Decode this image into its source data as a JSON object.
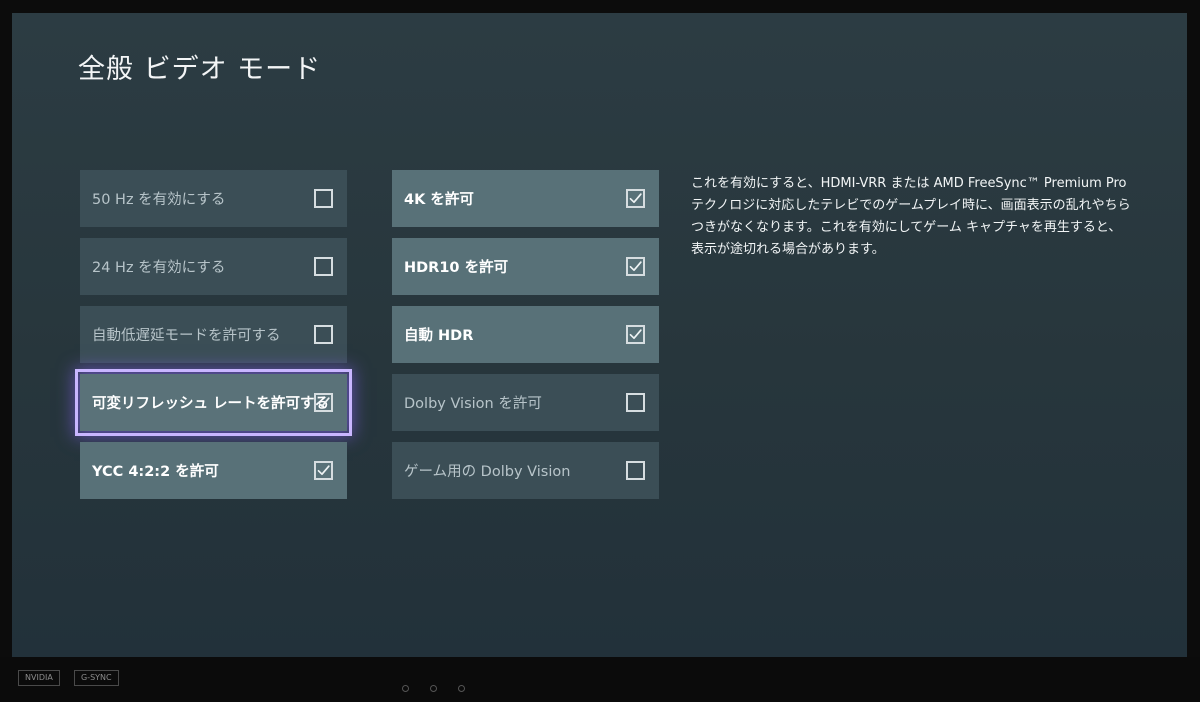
{
  "page_title": "全般 ビデオ モード",
  "left_options": [
    {
      "label": "50 Hz を有効にする",
      "checked": false,
      "state": "off"
    },
    {
      "label": "24 Hz を有効にする",
      "checked": false,
      "state": "off"
    },
    {
      "label": "自動低遅延モードを許可する",
      "checked": false,
      "state": "off"
    },
    {
      "label": "可変リフレッシュ レートを許可する",
      "checked": true,
      "state": "focused"
    },
    {
      "label": "YCC 4:2:2 を許可",
      "checked": true,
      "state": "on"
    }
  ],
  "right_options": [
    {
      "label": "4K を許可",
      "checked": true,
      "state": "on"
    },
    {
      "label": "HDR10 を許可",
      "checked": true,
      "state": "on"
    },
    {
      "label": "自動 HDR",
      "checked": true,
      "state": "on"
    },
    {
      "label": "Dolby Vision を許可",
      "checked": false,
      "state": "off"
    },
    {
      "label": "ゲーム用の Dolby Vision",
      "checked": false,
      "state": "off"
    }
  ],
  "description": "これを有効にすると、HDMI-VRR または AMD FreeSync™ Premium Pro テクノロジに対応したテレビでのゲームプレイ時に、画面表示の乱れやちらつきがなくなります。これを有効にしてゲーム キャプチャを再生すると、表示が途切れる場合があります。",
  "bezel": {
    "badge_nvidia": "NVIDIA",
    "badge_gsync": "G-SYNC"
  },
  "icons": {
    "checkbox_checked": "check-icon",
    "checkbox_unchecked": "empty-box-icon"
  }
}
